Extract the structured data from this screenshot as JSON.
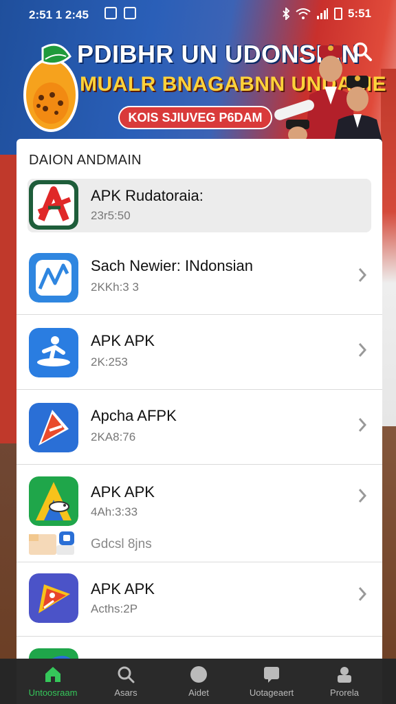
{
  "status_bar": {
    "time": "2:51 1 2:45",
    "right_text": "5:51",
    "icons": [
      "notification-icon",
      "image-icon",
      "bluetooth-icon",
      "wifi-icon",
      "signal-icon",
      "battery-icon"
    ]
  },
  "banner": {
    "title_line1": "PDIBHR UN UDONSIAN",
    "title_line2": "MUALR BNAGABNN UNDASIE",
    "pill_text": "KOIS SJIUVEG P6DAM",
    "search_icon": "search-icon",
    "colors": {
      "title_line2": "#ffd23a",
      "pill": "#d93a3a"
    }
  },
  "card": {
    "section_title": "DAION ANDMAIN",
    "apps": [
      {
        "name": "APK Rudatoraia:",
        "meta": "23r5:50",
        "icon": "red-a-arrow-icon",
        "highlighted": true
      },
      {
        "name": "Sach Newier: INdonsian",
        "meta": "2KKh:3 3",
        "icon": "blue-line-chart-icon"
      },
      {
        "name": "APK APK",
        "meta": "2K:253",
        "icon": "blue-surfer-icon"
      },
      {
        "name": "Apcha AFPK",
        "meta": "2KA8:76",
        "icon": "red-blue-arrow-icon"
      },
      {
        "name": "APK APK",
        "meta": "4Ah:3:33",
        "icon": "triangle-bird-icon",
        "sub_label": "Gdcsl 8jns",
        "sub_icon": "folder-app-icon"
      },
      {
        "name": "APK APK",
        "meta": "Acths:2P",
        "icon": "bird-kite-icon"
      }
    ],
    "chevron_icon": "chevron-right-icon"
  },
  "bottom_nav": {
    "items": [
      {
        "label": "Untoosraam",
        "icon": "home-icon",
        "active": true
      },
      {
        "label": "Asars",
        "icon": "search-icon",
        "active": false
      },
      {
        "label": "Aidet",
        "icon": "circle-icon",
        "active": false
      },
      {
        "label": "Uotageaert",
        "icon": "chat-icon",
        "active": false
      },
      {
        "label": "Prorela",
        "icon": "profile-icon",
        "active": false
      }
    ],
    "active_color": "#35c75a"
  }
}
